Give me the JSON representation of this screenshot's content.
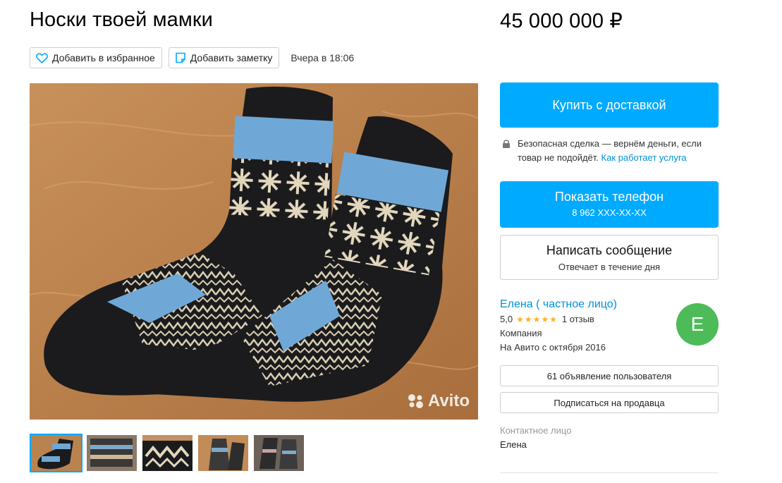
{
  "listing": {
    "title": "Носки твоей мамки",
    "price": "45 000 000 ₽",
    "favorite_label": "Добавить в избранное",
    "note_label": "Добавить заметку",
    "posted": "Вчера в 18:06",
    "watermark": "Avito"
  },
  "gallery": {
    "thumbnail_count": 5,
    "active_index": 0
  },
  "purchase": {
    "buy_label": "Купить с доставкой",
    "safe_text": "Безопасная сделка — вернём деньги, если товар не подойдёт.",
    "safe_link": "Как работает услуга",
    "phone_label": "Показать телефон",
    "phone_number": "8 962 XXX-XX-XX",
    "message_label": "Написать сообщение",
    "message_sub": "Отвечает в течение дня"
  },
  "seller": {
    "name": "Елена ( частное лицо)",
    "rating": "5,0",
    "stars": "★★★★★",
    "reviews": "1 отзыв",
    "type": "Компания",
    "since": "На Авито с октября 2016",
    "avatar_letter": "Е",
    "avatar_color": "#4cbb58",
    "ads_label": "61 объявление пользователя",
    "subscribe_label": "Подписаться на продавца"
  },
  "contact": {
    "label": "Контактное лицо",
    "name": "Елена"
  },
  "colors": {
    "accent": "#00aaff",
    "link": "#0091d9",
    "star": "#ffb021"
  }
}
